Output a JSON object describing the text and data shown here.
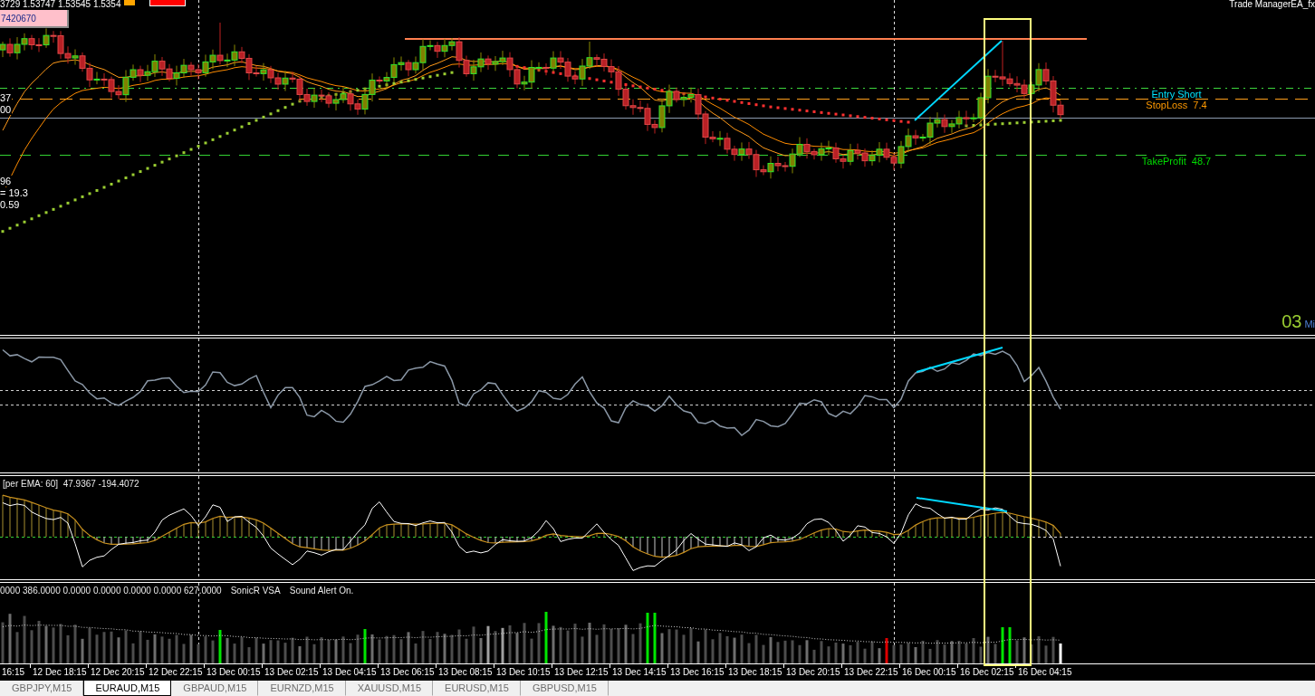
{
  "chart": {
    "price_info": "3729 1.53747 1.53545 1.5354",
    "account_label": "7420670",
    "ea_title": "Trade ManagerEA_fx",
    "left_readouts": [
      "37",
      "00",
      "96",
      "= 19.3",
      "0.59"
    ],
    "trade_levels": [
      {
        "kind": "entry",
        "label": "Entry Short",
        "color": "#00e5ff"
      },
      {
        "kind": "stop",
        "label": "StopLoss  7.4",
        "color": "#ff9900"
      },
      {
        "kind": "take",
        "label": "TakeProfit  48.7",
        "color": "#00dd00"
      }
    ],
    "timer": {
      "value": "03",
      "unit": "Mi"
    }
  },
  "oscillator": {
    "label": "[per EMA: 60]  47.9367 -194.4072"
  },
  "volume": {
    "labels": [
      "0000 386.0000 0.0000 0.0000 0.0000 0.0000 627.0000",
      "SonicR VSA",
      "Sound Alert On."
    ]
  },
  "time_axis": [
    "16:15",
    "12 Dec 18:15",
    "12 Dec 20:15",
    "12 Dec 22:15",
    "13 Dec 00:15",
    "13 Dec 02:15",
    "13 Dec 04:15",
    "13 Dec 06:15",
    "13 Dec 08:15",
    "13 Dec 10:15",
    "13 Dec 12:15",
    "13 Dec 14:15",
    "13 Dec 16:15",
    "13 Dec 18:15",
    "13 Dec 20:15",
    "13 Dec 22:15",
    "16 Dec 00:15",
    "16 Dec 02:15",
    "16 Dec 04:15"
  ],
  "tabs": [
    {
      "label": "GBPJPY,M15",
      "selected": false
    },
    {
      "label": "EURAUD,M15",
      "selected": true
    },
    {
      "label": "GBPAUD,M15",
      "selected": false
    },
    {
      "label": "EURNZD,M15",
      "selected": false
    },
    {
      "label": "XAUUSD,M15",
      "selected": false
    },
    {
      "label": "EURUSD,M15",
      "selected": false
    },
    {
      "label": "GBPUSD,M15",
      "selected": false
    }
  ]
}
